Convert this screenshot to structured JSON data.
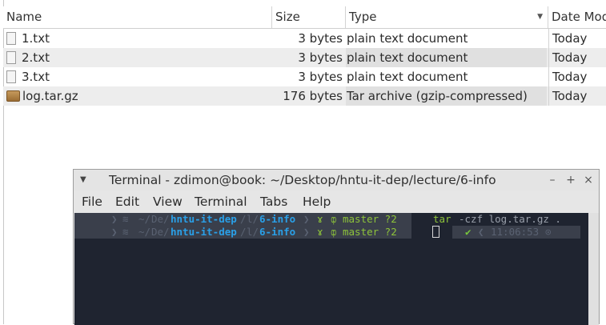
{
  "file_manager": {
    "columns": {
      "name": "Name",
      "size": "Size",
      "type": "Type",
      "date": "Date Mod"
    },
    "rows": [
      {
        "name": "1.txt",
        "size": "3 bytes",
        "type": "plain text document",
        "date": "Today",
        "icon": "text-file-icon"
      },
      {
        "name": "2.txt",
        "size": "3 bytes",
        "type": "plain text document",
        "date": "Today",
        "icon": "text-file-icon"
      },
      {
        "name": "3.txt",
        "size": "3 bytes",
        "type": "plain text document",
        "date": "Today",
        "icon": "text-file-icon"
      },
      {
        "name": "log.tar.gz",
        "size": "176 bytes",
        "type": "Tar archive (gzip-compressed)",
        "date": "Today",
        "icon": "archive-file-icon"
      }
    ]
  },
  "terminal": {
    "title": "Terminal - zdimon@book: ~/Desktop/hntu-it-dep/lecture/6-info",
    "window_buttons": {
      "minimize": "–",
      "maximize": "+",
      "close": "×"
    },
    "menu": [
      "File",
      "Edit",
      "View",
      "Terminal",
      "Tabs",
      "Help"
    ],
    "lines": [
      {
        "prompt_os": "",
        "path_home": "~/",
        "path_de": "De/",
        "path_repo": "hntu-it-dep",
        "path_sep": "/",
        "path_l": "l/",
        "path_dir": "6-info",
        "git_branch": "master ?2",
        "command_name": "tar",
        "command_args": "-czf log.tar.gz ."
      },
      {
        "prompt_os": "",
        "path_home": "~/",
        "path_de": "De/",
        "path_repo": "hntu-it-dep",
        "path_sep": "/",
        "path_l": "l/",
        "path_dir": "6-info",
        "git_branch": "master ?2",
        "status_ok": "✔",
        "time": "11:06:53"
      }
    ]
  },
  "colors": {
    "terminal_bg": "#1f2430",
    "path_blue": "#2aa0e8",
    "git_green": "#8ec43a",
    "row_alt": "#ededed"
  }
}
